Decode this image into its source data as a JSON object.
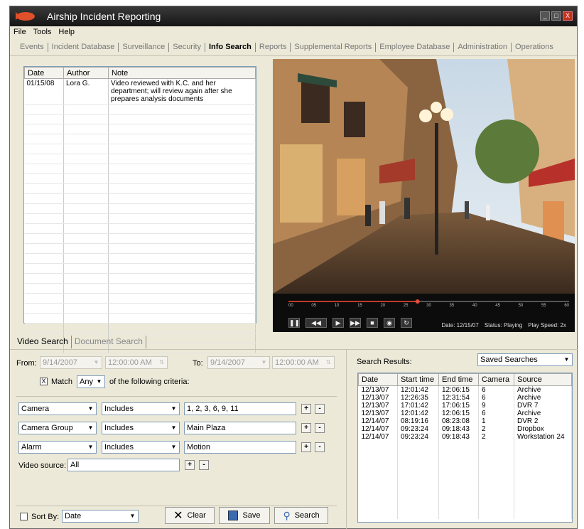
{
  "window": {
    "title": "Airship Incident Reporting",
    "controls": [
      "_",
      "□",
      "X"
    ]
  },
  "menu": [
    "File",
    "Tools",
    "Help"
  ],
  "tabs": [
    "Events",
    "Incident Database",
    "Surveillance",
    "Security",
    "Info Search",
    "Reports",
    "Supplemental Reports",
    "Employee Database",
    "Administration",
    "Operations"
  ],
  "active_tab": "Info Search",
  "notes": {
    "headers": [
      "Date",
      "Author",
      "Note"
    ],
    "rows": [
      {
        "date": "01/15/08",
        "author": "Lora G.",
        "note": "Video reviewed with K.C. and her department; will review again after she prepares analysis documents"
      }
    ]
  },
  "video": {
    "ticks": [
      "00",
      "05",
      "10",
      "15",
      "20",
      "25",
      "30",
      "35",
      "40",
      "45",
      "50",
      "55",
      "60"
    ],
    "status_date": "Date: 12/15/07",
    "status_state": "Status: Playing",
    "status_speed": "Play Speed: 2x",
    "progress": 0.46
  },
  "search_tabs": [
    "Video Search",
    "Document Search"
  ],
  "from": {
    "label": "From:",
    "date": "9/14/2007",
    "time": "12:00:00 AM"
  },
  "to": {
    "label": "To:",
    "date": "9/14/2007",
    "time": "12:00:00 AM"
  },
  "match": {
    "label": "Match",
    "value": "Any",
    "suffix": "of the following criteria:",
    "checked": "X"
  },
  "criteria": [
    {
      "field": "Camera",
      "op": "Includes",
      "value": "1, 2, 3, 6, 9, 11"
    },
    {
      "field": "Camera Group",
      "op": "Includes",
      "value": "Main Plaza"
    },
    {
      "field": "Alarm",
      "op": "Includes",
      "value": "Motion"
    }
  ],
  "video_source": {
    "label": "Video source:",
    "value": "All"
  },
  "sort": {
    "label": "Sort By:",
    "value": "Date"
  },
  "buttons": {
    "clear": "Clear",
    "save": "Save",
    "search": "Search"
  },
  "results": {
    "label": "Search Results:",
    "saved": "Saved Searches",
    "headers": [
      "Date",
      "Start time",
      "End time",
      "Camera",
      "Source"
    ],
    "rows": [
      [
        "12/13/07",
        "12:01:42",
        "12:06:15",
        "6",
        "Archive"
      ],
      [
        "12/13/07",
        "12:26:35",
        "12:31:54",
        "6",
        "Archive"
      ],
      [
        "12/13/07",
        "17:01:42",
        "17:06:15",
        "9",
        "DVR 7"
      ],
      [
        "12/13/07",
        "12:01:42",
        "12:06:15",
        "6",
        "Archive"
      ],
      [
        "12/14/07",
        "08:19:16",
        "08:23:08",
        "1",
        "DVR 2"
      ],
      [
        "12/14/07",
        "09:23:24",
        "09:18:43",
        "2",
        "Dropbox"
      ],
      [
        "12/14/07",
        "09:23:24",
        "09:18:43",
        "2",
        "Workstation 24"
      ]
    ]
  }
}
